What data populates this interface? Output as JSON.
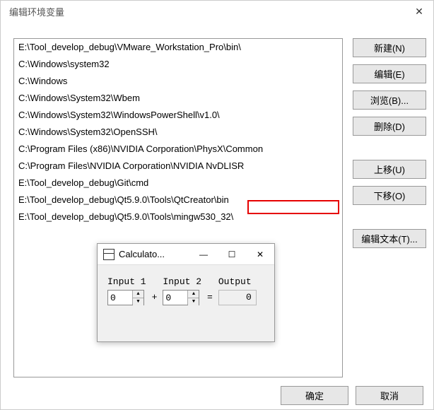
{
  "dialog": {
    "title": "编辑环境变量"
  },
  "paths": [
    "E:\\Tool_develop_debug\\VMware_Workstation_Pro\\bin\\",
    "C:\\Windows\\system32",
    "C:\\Windows",
    "C:\\Windows\\System32\\Wbem",
    "C:\\Windows\\System32\\WindowsPowerShell\\v1.0\\",
    "C:\\Windows\\System32\\OpenSSH\\",
    "C:\\Program Files (x86)\\NVIDIA Corporation\\PhysX\\Common",
    "C:\\Program Files\\NVIDIA Corporation\\NVIDIA NvDLISR",
    "E:\\Tool_develop_debug\\Git\\cmd",
    "E:\\Tool_develop_debug\\Qt5.9.0\\Tools\\QtCreator\\bin",
    "E:\\Tool_develop_debug\\Qt5.9.0\\Tools\\mingw530_32\\"
  ],
  "buttons": {
    "new": "新建(N)",
    "edit": "编辑(E)",
    "browse": "浏览(B)...",
    "delete": "删除(D)",
    "moveUp": "上移(U)",
    "moveDown": "下移(O)",
    "editText": "编辑文本(T)...",
    "ok": "确定",
    "cancel": "取消"
  },
  "calc": {
    "title": "Calculato...",
    "input1_label": "Input 1",
    "input2_label": "Input 2",
    "output_label": "Output",
    "input1_value": "0",
    "input2_value": "0",
    "output_value": "0",
    "plus": "+",
    "equals": "="
  }
}
